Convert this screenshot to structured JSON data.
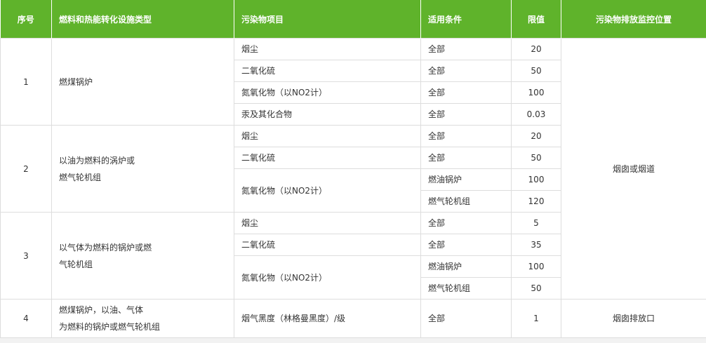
{
  "headers": [
    "序号",
    "燃料和热能转化设施类型",
    "污染物项目",
    "适用条件",
    "限值",
    "污染物排放监控位置"
  ],
  "groups": [
    {
      "no": "1",
      "type_lines": [
        "燃煤锅炉"
      ],
      "rows": [
        {
          "pollutant": "烟尘",
          "condition": "全部",
          "limit": "20"
        },
        {
          "pollutant": "二氧化硫",
          "condition": "全部",
          "limit": "50"
        },
        {
          "pollutant": "氮氧化物（以NO2计）",
          "condition": "全部",
          "limit": "100"
        },
        {
          "pollutant": "汞及其化合物",
          "condition": "全部",
          "limit": "0.03"
        }
      ]
    },
    {
      "no": "2",
      "type_lines": [
        "以油为燃料的涡炉或",
        "燃气轮机组"
      ],
      "rows": [
        {
          "pollutant": "烟尘",
          "condition": "全部",
          "limit": "20"
        },
        {
          "pollutant": "二氧化硫",
          "condition": "全部",
          "limit": "50"
        },
        {
          "pollutant": "氮氧化物（以NO2计）",
          "condition": "燃油锅炉",
          "limit": "100"
        },
        {
          "condition": "燃气轮机组",
          "limit": "120"
        }
      ]
    },
    {
      "no": "3",
      "type_lines": [
        "以气体为燃料的锅炉或燃",
        "气轮机组"
      ],
      "rows": [
        {
          "pollutant": "烟尘",
          "condition": "全部",
          "limit": "5"
        },
        {
          "pollutant": "二氧化硫",
          "condition": "全部",
          "limit": "35"
        },
        {
          "pollutant": "氮氧化物（以NO2计）",
          "condition": "燃油锅炉",
          "limit": "100"
        },
        {
          "condition": "燃气轮机组",
          "limit": "50"
        }
      ]
    },
    {
      "no": "4",
      "type_lines": [
        "燃煤锅炉，以油、气体",
        "为燃料的锅炉或燃气轮机组"
      ],
      "rows": [
        {
          "pollutant": "烟气黑度（林格曼黑度）/级",
          "condition": "全部",
          "limit": "1"
        }
      ]
    }
  ],
  "location_main": "烟囱或烟道",
  "location_last": "烟囱排放口"
}
